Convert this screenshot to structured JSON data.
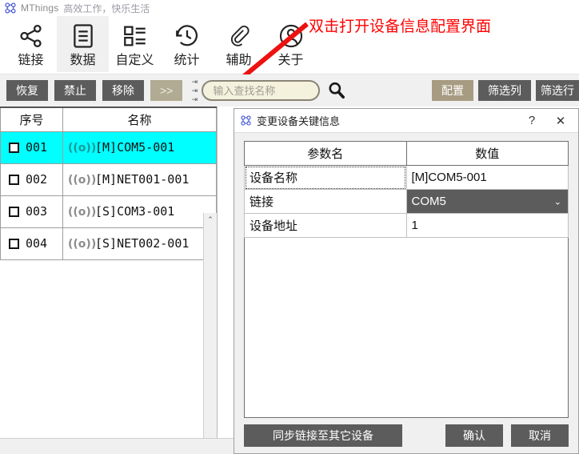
{
  "titlebar": {
    "logo_icon": "clover-logo-icon",
    "app_name": "MThings",
    "slogan": "高效工作，快乐生活"
  },
  "ribbon": {
    "tabs": [
      {
        "label": "链接",
        "icon": "share-nodes-icon",
        "active": false
      },
      {
        "label": "数据",
        "icon": "document-lines-icon",
        "active": true
      },
      {
        "label": "自定义",
        "icon": "list-blocks-icon",
        "active": false
      },
      {
        "label": "统计",
        "icon": "clock-history-icon",
        "active": false
      },
      {
        "label": "辅助",
        "icon": "paperclip-icon",
        "active": false
      },
      {
        "label": "关于",
        "icon": "user-circle-icon",
        "active": false
      }
    ]
  },
  "annotation": {
    "text": "双击打开设备信息配置界面",
    "color": "#ff0000",
    "arrow_icon": "red-arrow-icon"
  },
  "toolbar": {
    "left_buttons": [
      {
        "label": "恢复",
        "style": "dark"
      },
      {
        "label": "禁止",
        "style": "dark"
      },
      {
        "label": "移除",
        "style": "dark"
      },
      {
        "label": ">>",
        "style": "khaki"
      }
    ],
    "splitter_icon": "splitter-handle-icon",
    "search": {
      "placeholder": "输入查找名称",
      "value": "",
      "icon": "search-icon"
    },
    "right_buttons": [
      {
        "label": "配置",
        "style": "tan"
      },
      {
        "label": "筛选列",
        "style": "dark"
      },
      {
        "label": "筛选行",
        "style": "dark"
      }
    ]
  },
  "device_list": {
    "columns": [
      "序号",
      "名称"
    ],
    "scrollbar_up_icon": "chevron-up-icon",
    "rows": [
      {
        "index": "001",
        "name": "[M]COM5-001",
        "icon": "signal-broadcast-icon",
        "checked": false,
        "selected": true
      },
      {
        "index": "002",
        "name": "[M]NET001-001",
        "icon": "signal-broadcast-icon",
        "checked": false,
        "selected": false
      },
      {
        "index": "003",
        "name": "[S]COM3-001",
        "icon": "signal-broadcast-icon",
        "checked": false,
        "selected": false
      },
      {
        "index": "004",
        "name": "[S]NET002-001",
        "icon": "signal-broadcast-icon",
        "checked": false,
        "selected": false
      }
    ]
  },
  "dialog": {
    "logo_icon": "clover-logo-icon",
    "title": "变更设备关键信息",
    "help_label": "?",
    "close_label": "✕",
    "table": {
      "headers": [
        "参数名",
        "数值"
      ],
      "rows": [
        {
          "key": "设备名称",
          "value": "[M]COM5-001",
          "kind": "text",
          "focused": true
        },
        {
          "key": "链接",
          "value": "COM5",
          "kind": "dropdown",
          "caret_icon": "chevron-down-icon",
          "focused": false
        },
        {
          "key": "设备地址",
          "value": "1",
          "kind": "text",
          "focused": false
        }
      ]
    },
    "footer": {
      "sync_label": "同步链接至其它设备",
      "confirm_label": "确认",
      "cancel_label": "取消"
    }
  },
  "colors": {
    "selection_cyan": "#00ffff",
    "button_dark": "#5c5c5c",
    "button_tan": "#a79c82",
    "button_khaki": "#b2ab93",
    "annotation_red": "#ff0000",
    "logo_blue": "#3b4fd0"
  }
}
